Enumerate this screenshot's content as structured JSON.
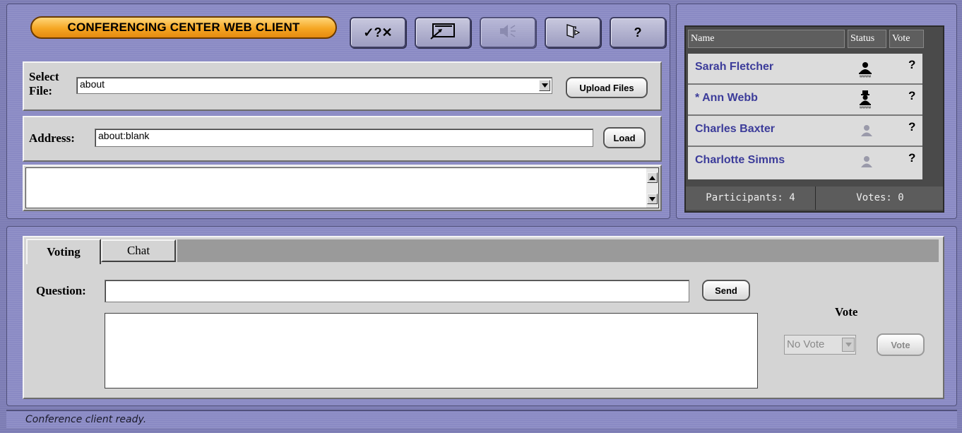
{
  "app": {
    "title": "CONFERENCING CENTER WEB CLIENT"
  },
  "toolbar": {
    "buttons": [
      {
        "name": "vote-tools-button",
        "label": "✓?✕",
        "enabled": true
      },
      {
        "name": "whiteboard-button",
        "icon": "pointer-screen-icon",
        "enabled": true
      },
      {
        "name": "audio-button",
        "icon": "speaker-icon",
        "enabled": false
      },
      {
        "name": "exit-button",
        "icon": "exit-door-icon",
        "enabled": true
      },
      {
        "name": "help-button",
        "label": "?",
        "enabled": true
      }
    ]
  },
  "file": {
    "label_line1": "Select",
    "label_line2": "File:",
    "selected": "about",
    "upload_label": "Upload Files"
  },
  "address": {
    "label": "Address:",
    "value": "about:blank",
    "load_label": "Load"
  },
  "participants": {
    "headers": {
      "name": "Name",
      "status": "Status",
      "vote": "Vote"
    },
    "rows": [
      {
        "name": "Sarah Fletcher",
        "status_icon": "user-hat-icon",
        "status_active": true,
        "vote": "?"
      },
      {
        "name": "* Ann Webb",
        "status_icon": "user-tophat-icon",
        "status_active": true,
        "vote": "?"
      },
      {
        "name": "Charles Baxter",
        "status_icon": "user-icon",
        "status_active": false,
        "vote": "?"
      },
      {
        "name": "Charlotte Simms",
        "status_icon": "user-icon",
        "status_active": false,
        "vote": "?"
      }
    ],
    "footer": {
      "participants": "Participants: 4",
      "votes": "Votes: 0"
    }
  },
  "tabs": [
    {
      "label": "Voting",
      "active": true
    },
    {
      "label": "Chat",
      "active": false
    }
  ],
  "voting": {
    "question_label": "Question:",
    "question_value": "",
    "send_label": "Send",
    "vote_heading": "Vote",
    "vote_select": "No Vote",
    "vote_button": "Vote"
  },
  "status_bar": {
    "text": "Conference client ready."
  },
  "colors": {
    "accent": "#f5a623",
    "frame": "#8a8ac4",
    "name_text": "#3c3c9a",
    "panel": "#d4d4d4"
  }
}
